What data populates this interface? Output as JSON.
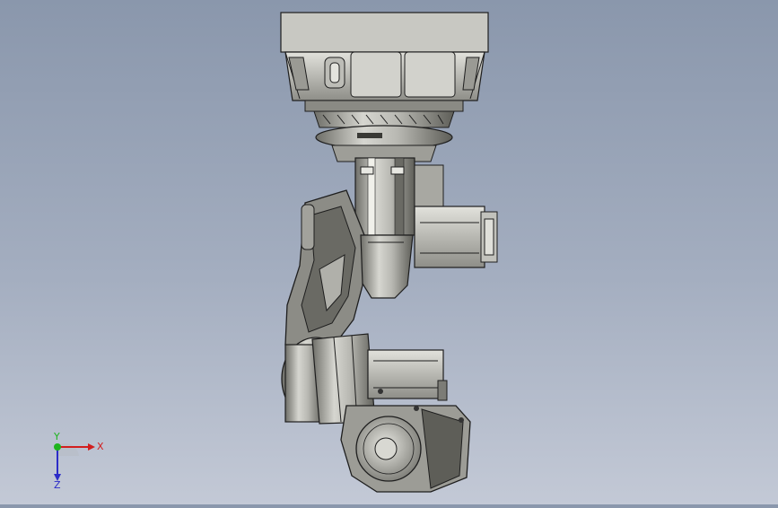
{
  "viewport": {
    "background_top": "#8a97ac",
    "background_bottom": "#c3c9d6",
    "model": "robot-arm-assembly"
  },
  "triad": {
    "x_label": "X",
    "y_label": "Y",
    "z_label": "Z",
    "x_color": "#d21e1e",
    "y_color": "#1eb41e",
    "z_color": "#2c2cc8"
  }
}
